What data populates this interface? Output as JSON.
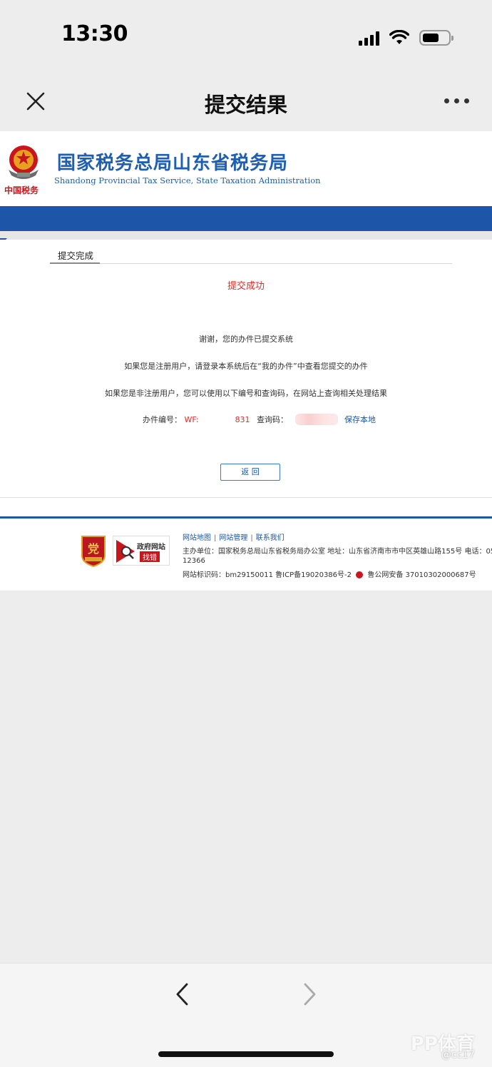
{
  "status_bar": {
    "time": "13:30"
  },
  "nav": {
    "title": "提交结果"
  },
  "site": {
    "name_cn": "国家税务总局山东省税务局",
    "name_en": "Shandong Provincial Tax Service, State Taxation Administration",
    "slogan": "中国税务"
  },
  "panel": {
    "tab_label": "提交完成",
    "success_text": "提交成功",
    "line1": "谢谢，您的办件已提交系统",
    "line2": "如果您是注册用户，请登录本系统后在“我的办件”中查看您提交的办件",
    "line3": "如果您是非注册用户，您可以使用以下编号和查询码，在网站上查询相关处理结果",
    "case_no_label": "办件编号：",
    "case_no_prefix": "WF:",
    "case_no_suffix": "831",
    "query_code_label": "查询码：",
    "save_local": "保存本地",
    "back_button": "返 回"
  },
  "footer": {
    "links": [
      "网站地图",
      "网站管理",
      "联系我们"
    ],
    "sep": "|",
    "host_line": "主办单位：国家税务总局山东省税务局办公室 地址：山东省济南市市中区英雄山路155号 电话：05",
    "host_line_cont": "12366",
    "id_line_a": "网站标识码：bm29150011 鲁ICP备19020386号-2",
    "id_line_b": "鲁公网安备 37010302000687号",
    "badge2_text1": "政府网站",
    "badge2_text2": "找错"
  },
  "watermark": {
    "logo": "PP体育",
    "handle": "@cc17"
  },
  "colors": {
    "brand_blue": "#1d56a8",
    "success_red": "#e32a2a",
    "slogan_red": "#c8161d",
    "page_bg": "#ededed"
  },
  "icons": {
    "close": "close-icon",
    "more": "more-icon",
    "back": "chevron-left-icon",
    "forward": "chevron-right-icon",
    "emblem": "national-emblem-icon",
    "party_badge": "party-badge-icon",
    "gov_site": "gov-site-error-icon",
    "police": "police-badge-icon"
  }
}
